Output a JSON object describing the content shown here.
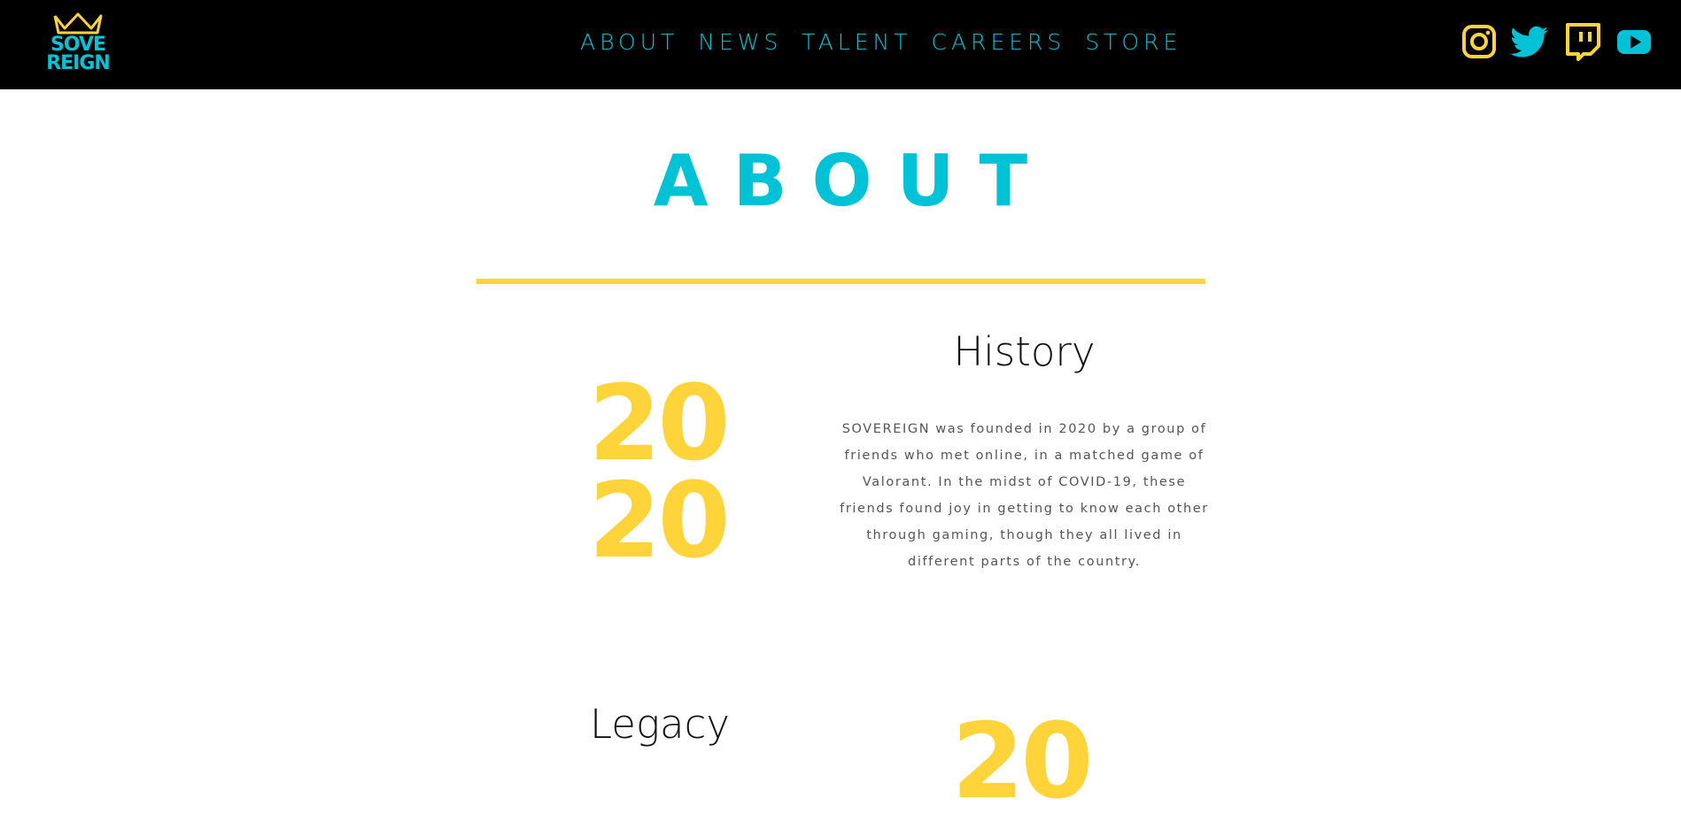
{
  "brand": {
    "logo_line1": "SOVE",
    "logo_line2": "REIGN",
    "primary_color": "#00c2d6",
    "accent_color": "#ffd43b",
    "header_bg": "#000000"
  },
  "nav": {
    "items": [
      {
        "label": "ABOUT"
      },
      {
        "label": "NEWS"
      },
      {
        "label": "TALENT"
      },
      {
        "label": "CAREERS"
      },
      {
        "label": "STORE"
      }
    ]
  },
  "social": [
    {
      "icon": "instagram-icon",
      "color": "#ffd43b"
    },
    {
      "icon": "twitter-icon",
      "color": "#00c2d6"
    },
    {
      "icon": "twitch-icon",
      "color": "#ffd43b"
    },
    {
      "icon": "youtube-icon",
      "color": "#00c2d6"
    }
  ],
  "about": {
    "title": "ABOUT"
  },
  "history": {
    "year_top": "20",
    "year_bottom": "20",
    "heading": "History",
    "body": "SOVEREIGN was founded in 2020 by a group of friends who met online, in a matched game of Valorant. In the midst of COVID-19, these friends found joy in getting to know each other through gaming, though they all lived in different parts of the country."
  },
  "legacy": {
    "heading": "Legacy",
    "year_top": "20"
  }
}
